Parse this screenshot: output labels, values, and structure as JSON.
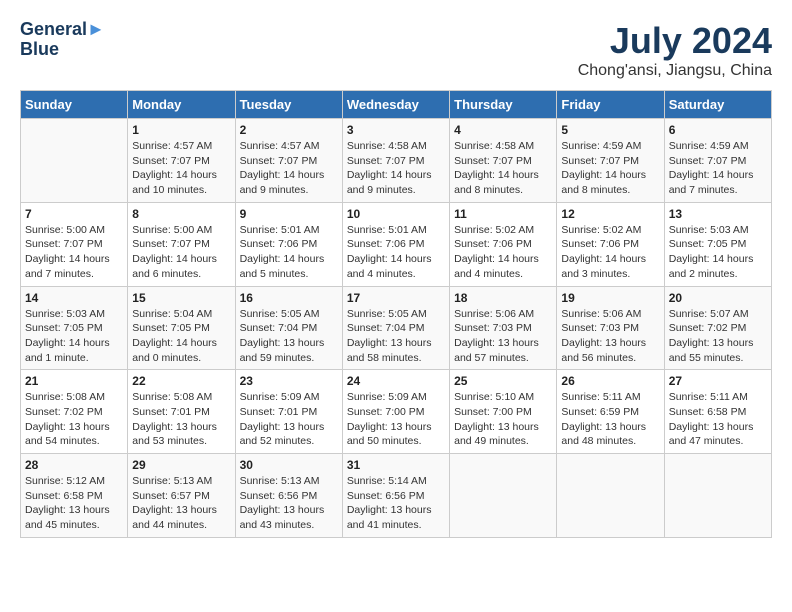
{
  "header": {
    "logo_line1": "General",
    "logo_line2": "Blue",
    "main_title": "July 2024",
    "subtitle": "Chong'ansi, Jiangsu, China"
  },
  "days_of_week": [
    "Sunday",
    "Monday",
    "Tuesday",
    "Wednesday",
    "Thursday",
    "Friday",
    "Saturday"
  ],
  "weeks": [
    [
      {
        "day": "",
        "info": ""
      },
      {
        "day": "1",
        "info": "Sunrise: 4:57 AM\nSunset: 7:07 PM\nDaylight: 14 hours\nand 10 minutes."
      },
      {
        "day": "2",
        "info": "Sunrise: 4:57 AM\nSunset: 7:07 PM\nDaylight: 14 hours\nand 9 minutes."
      },
      {
        "day": "3",
        "info": "Sunrise: 4:58 AM\nSunset: 7:07 PM\nDaylight: 14 hours\nand 9 minutes."
      },
      {
        "day": "4",
        "info": "Sunrise: 4:58 AM\nSunset: 7:07 PM\nDaylight: 14 hours\nand 8 minutes."
      },
      {
        "day": "5",
        "info": "Sunrise: 4:59 AM\nSunset: 7:07 PM\nDaylight: 14 hours\nand 8 minutes."
      },
      {
        "day": "6",
        "info": "Sunrise: 4:59 AM\nSunset: 7:07 PM\nDaylight: 14 hours\nand 7 minutes."
      }
    ],
    [
      {
        "day": "7",
        "info": "Sunrise: 5:00 AM\nSunset: 7:07 PM\nDaylight: 14 hours\nand 7 minutes."
      },
      {
        "day": "8",
        "info": "Sunrise: 5:00 AM\nSunset: 7:07 PM\nDaylight: 14 hours\nand 6 minutes."
      },
      {
        "day": "9",
        "info": "Sunrise: 5:01 AM\nSunset: 7:06 PM\nDaylight: 14 hours\nand 5 minutes."
      },
      {
        "day": "10",
        "info": "Sunrise: 5:01 AM\nSunset: 7:06 PM\nDaylight: 14 hours\nand 4 minutes."
      },
      {
        "day": "11",
        "info": "Sunrise: 5:02 AM\nSunset: 7:06 PM\nDaylight: 14 hours\nand 4 minutes."
      },
      {
        "day": "12",
        "info": "Sunrise: 5:02 AM\nSunset: 7:06 PM\nDaylight: 14 hours\nand 3 minutes."
      },
      {
        "day": "13",
        "info": "Sunrise: 5:03 AM\nSunset: 7:05 PM\nDaylight: 14 hours\nand 2 minutes."
      }
    ],
    [
      {
        "day": "14",
        "info": "Sunrise: 5:03 AM\nSunset: 7:05 PM\nDaylight: 14 hours\nand 1 minute."
      },
      {
        "day": "15",
        "info": "Sunrise: 5:04 AM\nSunset: 7:05 PM\nDaylight: 14 hours\nand 0 minutes."
      },
      {
        "day": "16",
        "info": "Sunrise: 5:05 AM\nSunset: 7:04 PM\nDaylight: 13 hours\nand 59 minutes."
      },
      {
        "day": "17",
        "info": "Sunrise: 5:05 AM\nSunset: 7:04 PM\nDaylight: 13 hours\nand 58 minutes."
      },
      {
        "day": "18",
        "info": "Sunrise: 5:06 AM\nSunset: 7:03 PM\nDaylight: 13 hours\nand 57 minutes."
      },
      {
        "day": "19",
        "info": "Sunrise: 5:06 AM\nSunset: 7:03 PM\nDaylight: 13 hours\nand 56 minutes."
      },
      {
        "day": "20",
        "info": "Sunrise: 5:07 AM\nSunset: 7:02 PM\nDaylight: 13 hours\nand 55 minutes."
      }
    ],
    [
      {
        "day": "21",
        "info": "Sunrise: 5:08 AM\nSunset: 7:02 PM\nDaylight: 13 hours\nand 54 minutes."
      },
      {
        "day": "22",
        "info": "Sunrise: 5:08 AM\nSunset: 7:01 PM\nDaylight: 13 hours\nand 53 minutes."
      },
      {
        "day": "23",
        "info": "Sunrise: 5:09 AM\nSunset: 7:01 PM\nDaylight: 13 hours\nand 52 minutes."
      },
      {
        "day": "24",
        "info": "Sunrise: 5:09 AM\nSunset: 7:00 PM\nDaylight: 13 hours\nand 50 minutes."
      },
      {
        "day": "25",
        "info": "Sunrise: 5:10 AM\nSunset: 7:00 PM\nDaylight: 13 hours\nand 49 minutes."
      },
      {
        "day": "26",
        "info": "Sunrise: 5:11 AM\nSunset: 6:59 PM\nDaylight: 13 hours\nand 48 minutes."
      },
      {
        "day": "27",
        "info": "Sunrise: 5:11 AM\nSunset: 6:58 PM\nDaylight: 13 hours\nand 47 minutes."
      }
    ],
    [
      {
        "day": "28",
        "info": "Sunrise: 5:12 AM\nSunset: 6:58 PM\nDaylight: 13 hours\nand 45 minutes."
      },
      {
        "day": "29",
        "info": "Sunrise: 5:13 AM\nSunset: 6:57 PM\nDaylight: 13 hours\nand 44 minutes."
      },
      {
        "day": "30",
        "info": "Sunrise: 5:13 AM\nSunset: 6:56 PM\nDaylight: 13 hours\nand 43 minutes."
      },
      {
        "day": "31",
        "info": "Sunrise: 5:14 AM\nSunset: 6:56 PM\nDaylight: 13 hours\nand 41 minutes."
      },
      {
        "day": "",
        "info": ""
      },
      {
        "day": "",
        "info": ""
      },
      {
        "day": "",
        "info": ""
      }
    ]
  ]
}
